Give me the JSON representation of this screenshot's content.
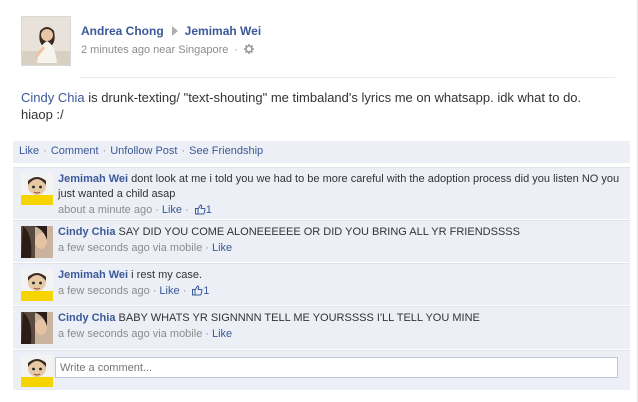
{
  "post": {
    "author": "Andrea Chong",
    "target": "Jemimah Wei",
    "time": "2 minutes ago near Singapore",
    "gear_icon": "gear-icon",
    "tagged_name": "Cindy Chia",
    "message": " is drunk-texting/ \"text-shouting\" me timbaland's lyrics me on whatsapp. idk what to do. hiaop :/"
  },
  "actions": {
    "like": "Like",
    "comment": "Comment",
    "unfollow": "Unfollow Post",
    "friendship": "See Friendship",
    "separator": "·"
  },
  "comments": [
    {
      "name": "Jemimah Wei",
      "text": "dont look at me i told you we had to be more careful with the adoption process did you listen NO you just wanted a child asap",
      "time": "about a minute ago",
      "action": "Like",
      "likes": "1"
    },
    {
      "name": "Cindy Chia",
      "text": "SAY DID YOU COME ALONEEEEEE OR DID YOU BRING ALL YR FRIENDSSSS",
      "time": "a few seconds ago via mobile",
      "action": "Like"
    },
    {
      "name": "Jemimah Wei",
      "text": "i rest my case.",
      "time": "a few seconds ago",
      "action": "Like",
      "likes": "1"
    },
    {
      "name": "Cindy Chia",
      "text": "BABY WHATS YR SIGNNNN TELL ME YOURSSSS I'LL TELL YOU MINE",
      "time": "a few seconds ago via mobile",
      "action": "Like"
    }
  ],
  "composer": {
    "placeholder": "Write a comment..."
  },
  "colors": {
    "link": "#3b5998",
    "panel": "#eceff5",
    "meta": "#8c8c8c"
  }
}
